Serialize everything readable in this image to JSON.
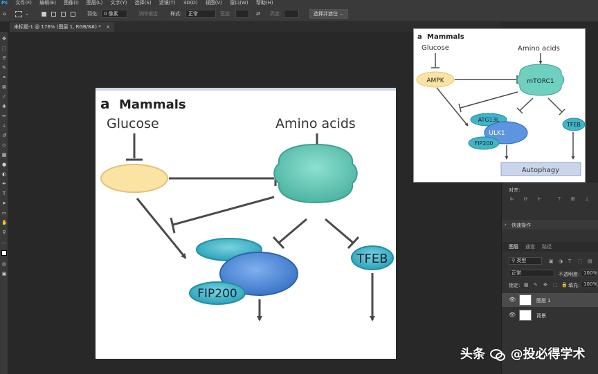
{
  "menu": {
    "logo": "Ps",
    "items": [
      "文件(F)",
      "编辑(E)",
      "图像(I)",
      "图层(L)",
      "文字(Y)",
      "选择(S)",
      "滤镜(T)",
      "3D(D)",
      "视图(V)",
      "窗口(W)",
      "帮助(H)"
    ]
  },
  "options": {
    "feather_label": "羽化:",
    "feather_value": "0 像素",
    "antialias_label": "消除锯齿",
    "style_label": "样式:",
    "style_value": "正常",
    "width_label": "宽度:",
    "height_label": "高度:",
    "select_mask_button": "选择并遮住 ..."
  },
  "tab": {
    "title": "未标题-1 @ 176% (图层 1, RGB/8#) *",
    "close": "×"
  },
  "figure": {
    "panel_letter": "a",
    "panel_title": "Mammals",
    "labels": {
      "glucose": "Glucose",
      "amino_acids": "Amino acids",
      "tfeb": "TFEB",
      "fip200": "FIP200"
    }
  },
  "thumbnail": {
    "panel_letter": "a",
    "panel_title": "Mammals",
    "labels": {
      "glucose": "Glucose",
      "amino_acids": "Amino acids",
      "ampk": "AMPK",
      "mtorc1": "mTORC1",
      "atg13l": "ATG13L",
      "ulk1": "ULK1",
      "fip200": "FIP200",
      "tfeb": "TFEB",
      "autophagy": "Autophagy"
    }
  },
  "panels": {
    "align_label": "对齐:",
    "quick_actions": "快速操作",
    "tabs": [
      "图层",
      "通道",
      "路径"
    ],
    "kind_filter": "类型",
    "blend_mode": "正常",
    "opacity_label": "不透明度:",
    "opacity_value": "100%",
    "lock_label": "锁定:",
    "fill_label": "填充:",
    "fill_value": "100%",
    "layers": [
      {
        "name": "图层 1"
      },
      {
        "name": "背景"
      }
    ]
  },
  "watermark": {
    "prefix": "头条",
    "handle": "@投必得学术"
  },
  "colors": {
    "app_bg": "#282828",
    "panel_bg": "#3a3a3a",
    "teal": "#5cc6b4",
    "blue": "#4a88d8",
    "yellow": "#fbe3a3",
    "autophagy_box": "#c9d5ea"
  }
}
